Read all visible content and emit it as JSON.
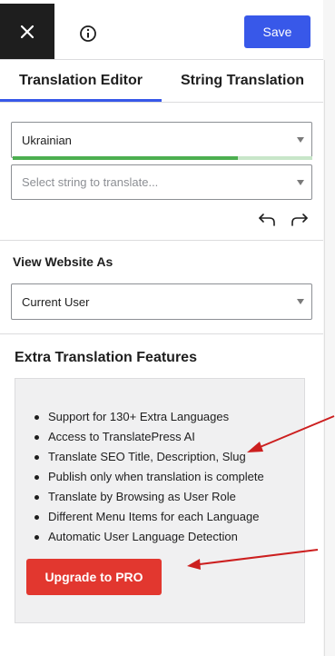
{
  "header": {
    "save_label": "Save"
  },
  "tabs": [
    {
      "label": "Translation Editor",
      "active": true
    },
    {
      "label": "String Translation",
      "active": false
    }
  ],
  "language_select": {
    "value": "Ukrainian",
    "progress": 0.75
  },
  "string_select": {
    "placeholder": "Select string to translate..."
  },
  "view_as": {
    "heading": "View Website As",
    "value": "Current User"
  },
  "extra_features": {
    "heading": "Extra Translation Features",
    "items": [
      "Support for 130+ Extra Languages",
      "Access to TranslatePress AI",
      "Translate SEO Title, Description, Slug",
      "Publish only when translation is complete",
      "Translate by Browsing as User Role",
      "Different Menu Items for each Language",
      "Automatic User Language Detection"
    ],
    "upgrade_label": "Upgrade to PRO"
  },
  "icons": {
    "close": "close-icon",
    "info": "info-icon",
    "undo": "undo-icon",
    "redo": "redo-icon"
  },
  "colors": {
    "accent": "#3858e9",
    "upgrade": "#e2372f",
    "progress": "#4caf50",
    "annotation_arrow": "#cc1f1f"
  }
}
